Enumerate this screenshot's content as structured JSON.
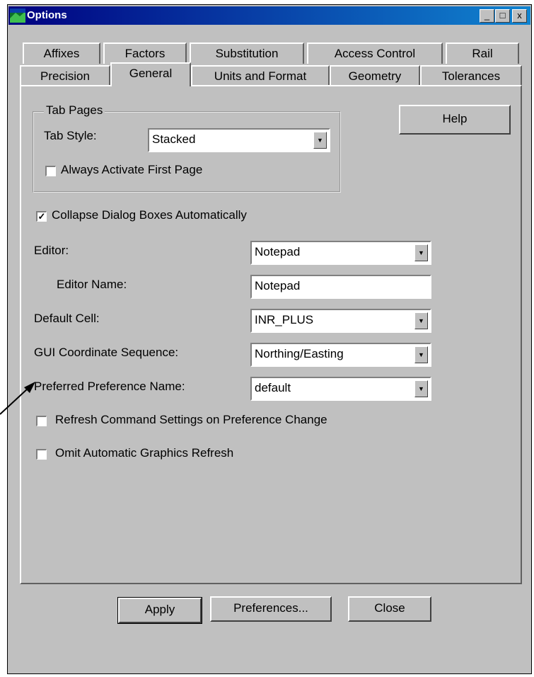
{
  "window": {
    "title": "Options"
  },
  "title_buttons": {
    "minimize": "_",
    "maximize": "□",
    "close": "x"
  },
  "tabs_row1": [
    "Affixes",
    "Factors",
    "Substitution",
    "Access Control",
    "Rail"
  ],
  "tabs_row2": [
    "Precision",
    "General",
    "Units and Format",
    "Geometry",
    "Tolerances"
  ],
  "active_tab": "General",
  "tab_pages": {
    "legend": "Tab Pages",
    "tab_style_label": "Tab Style:",
    "tab_style_value": "Stacked",
    "always_first_label": "Always Activate First Page",
    "always_first_checked": false
  },
  "help_label": "Help",
  "collapse_label": "Collapse Dialog Boxes Automatically",
  "collapse_checked": true,
  "check_mark": "✓",
  "editor": {
    "label": "Editor:",
    "value": "Notepad"
  },
  "editor_name": {
    "label": "Editor Name:",
    "value": "Notepad"
  },
  "default_cell": {
    "label": "Default Cell:",
    "value": "INR_PLUS"
  },
  "gui_coord": {
    "label": "GUI Coordinate Sequence:",
    "value": "Northing/Easting"
  },
  "pref_name": {
    "label": "Preferred Preference Name:",
    "value": "default"
  },
  "refresh_label": "Refresh Command Settings on Preference Change",
  "omit_label": "Omit Automatic Graphics Refresh",
  "buttons": {
    "apply": "Apply",
    "preferences": "Preferences...",
    "close": "Close"
  },
  "dropdown_arrow": "▼"
}
